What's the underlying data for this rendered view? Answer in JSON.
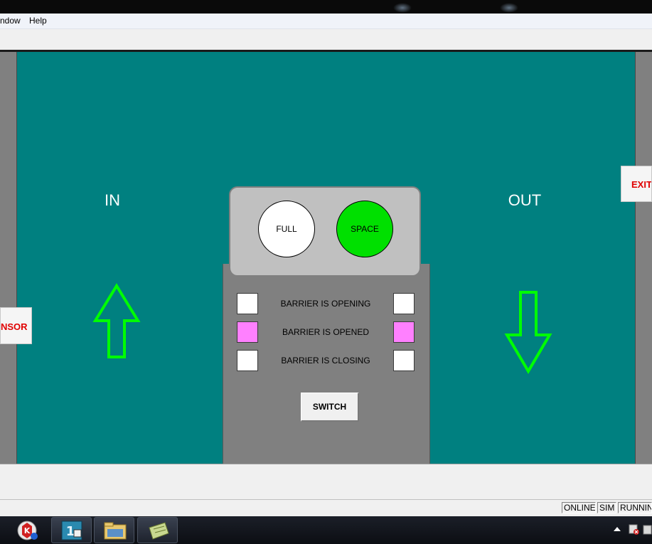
{
  "menu": {
    "items": [
      "ndow",
      "Help"
    ]
  },
  "canvas": {
    "in_label": "IN",
    "out_label": "OUT",
    "left_tag": "NSOR",
    "right_tag": "EXIT"
  },
  "lamps": {
    "full": {
      "label": "FULL",
      "color": "#ffffff"
    },
    "space": {
      "label": "SPACE",
      "color": "#00e000"
    }
  },
  "barrier_status": [
    {
      "label": "BARRIER IS OPENING",
      "left_color": "#ffffff",
      "right_color": "#ffffff"
    },
    {
      "label": "BARRIER IS OPENED",
      "left_color": "#ff80ff",
      "right_color": "#ff80ff"
    },
    {
      "label": "BARRIER IS CLOSING",
      "left_color": "#ffffff",
      "right_color": "#ffffff"
    }
  ],
  "switch_button": {
    "label": "SWITCH"
  },
  "statusbar": {
    "cells": [
      "ONLINE",
      "SIM",
      "RUNNING"
    ]
  },
  "taskbar": {
    "icons": [
      "start-icon",
      "app-icon",
      "file-explorer-icon",
      "notes-icon"
    ]
  },
  "colors": {
    "canvas": "#008080",
    "arrow": "#00ff00",
    "tag_text": "#e00000"
  }
}
